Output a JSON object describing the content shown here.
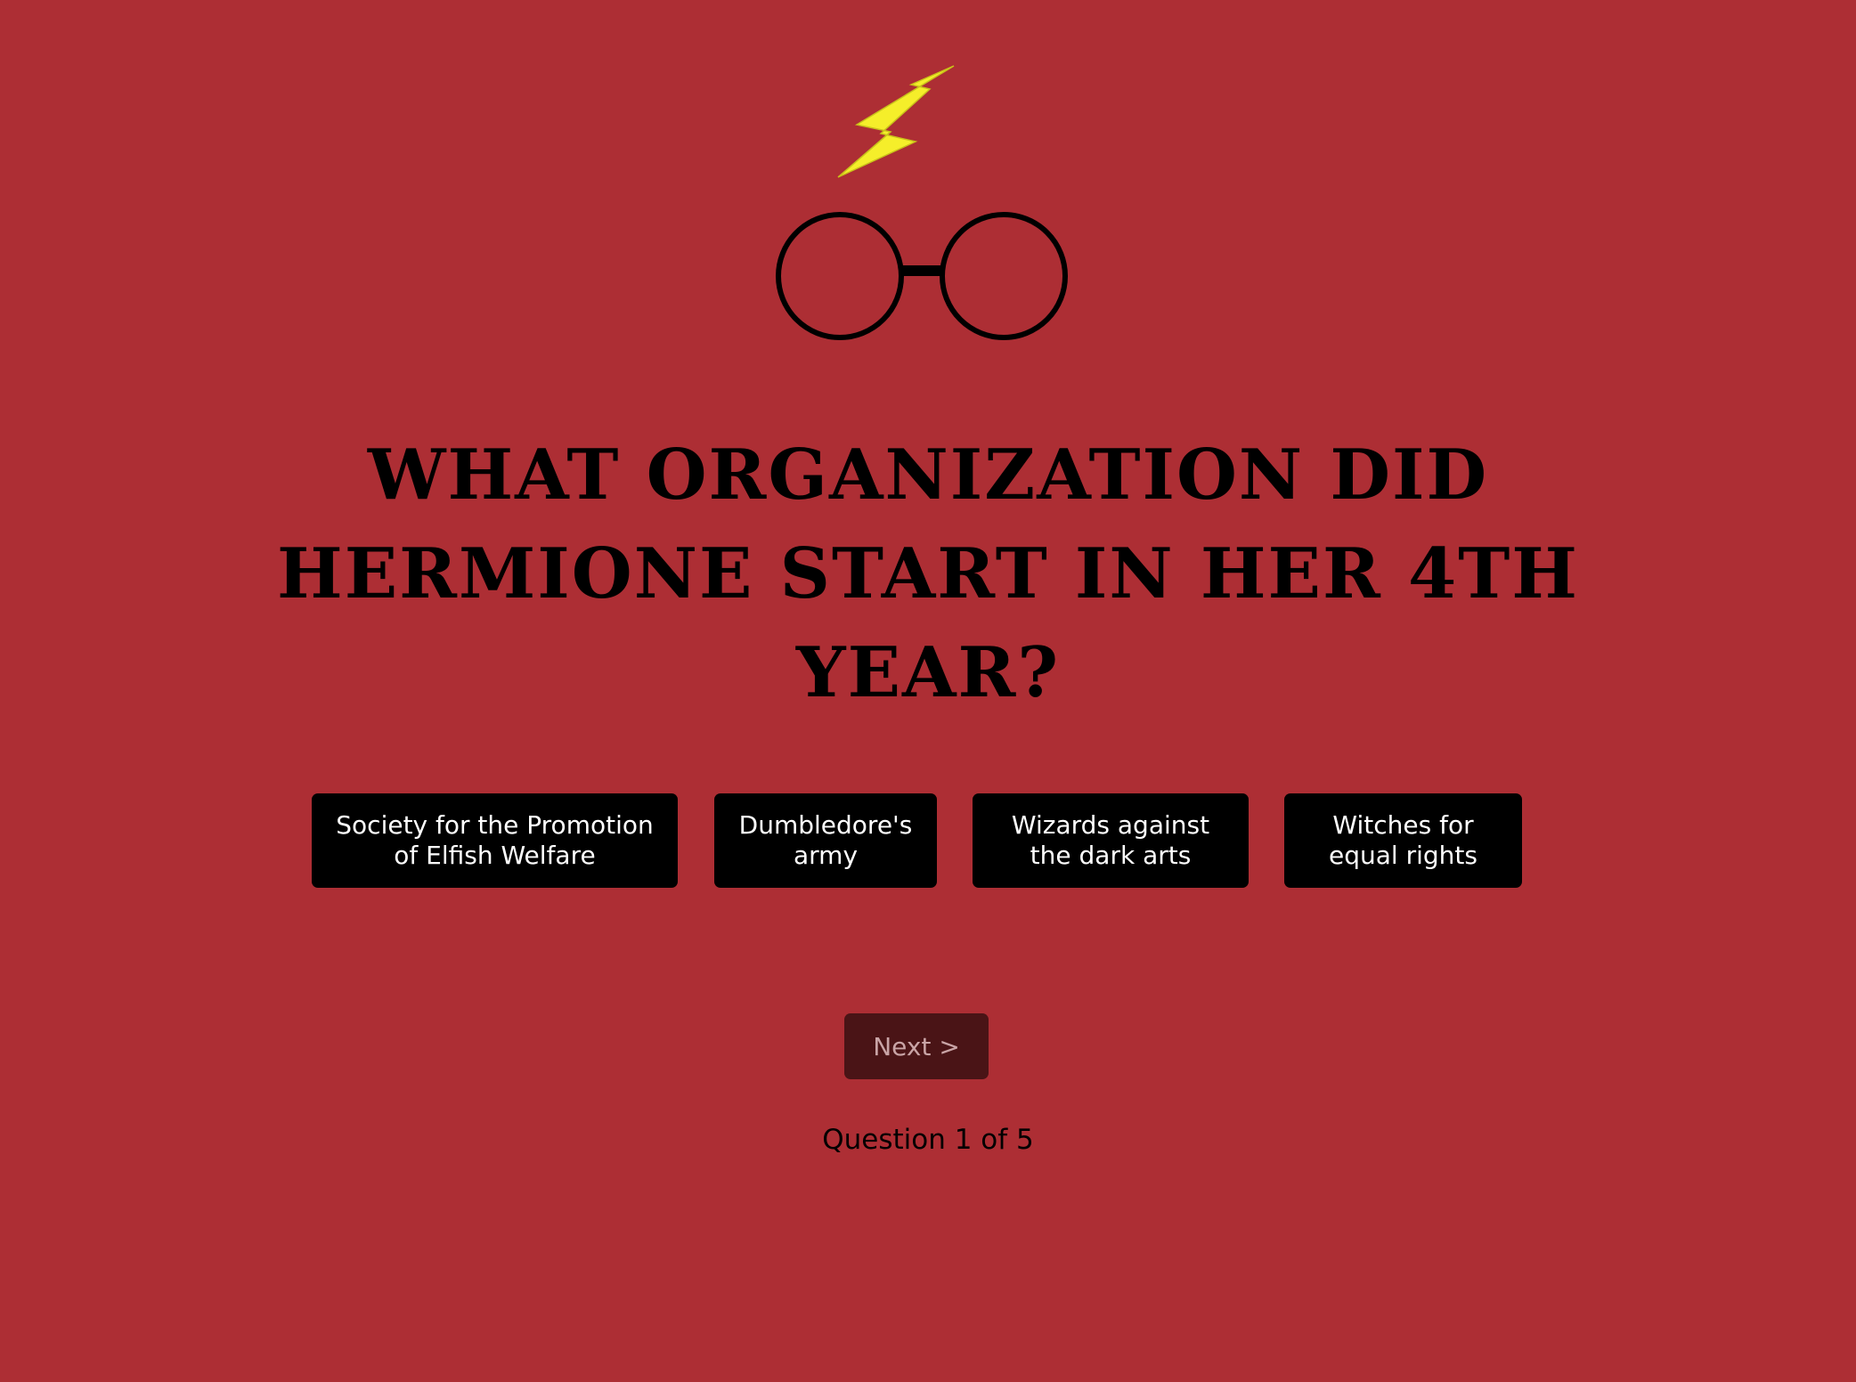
{
  "header": {
    "logo_icon": "lightning-bolt-and-round-glasses",
    "bolt_color": "#f5ee2a",
    "glasses_color": "#000000"
  },
  "quiz": {
    "question": "What organization did Hermione start in her 4th year?",
    "answers": [
      {
        "label": "Society for the Promotion of Elfish Welfare"
      },
      {
        "label": "Dumbledore's army"
      },
      {
        "label": "Wizards against the dark arts"
      },
      {
        "label": "Witches for equal rights"
      }
    ],
    "next_label": "Next >",
    "progress_text": "Question 1 of 5",
    "current_question": 1,
    "total_questions": 5
  },
  "theme": {
    "background": "#ad2e34",
    "answer_bg": "#000000",
    "answer_text": "#ffffff",
    "next_bg": "#4a1416",
    "next_text": "#c9a4a6"
  }
}
